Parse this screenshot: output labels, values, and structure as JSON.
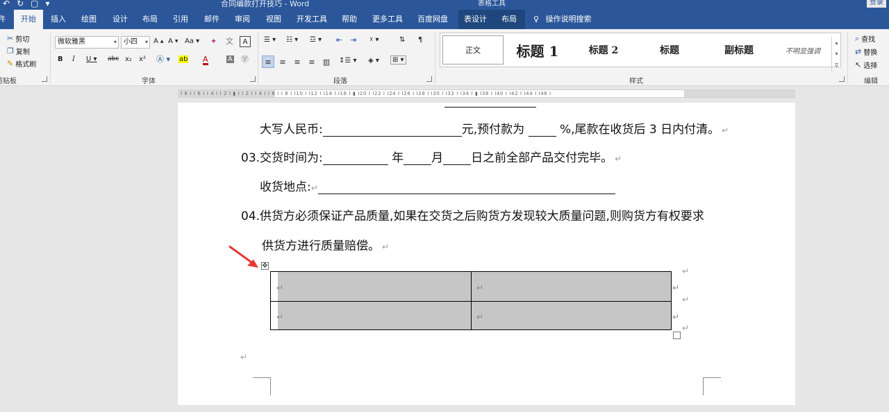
{
  "titlebar": {
    "doc_title": "合同编款打开技巧 - Word",
    "context_title": "表格工具",
    "login": "登录"
  },
  "tabs": [
    {
      "label": "文件"
    },
    {
      "label": "开始"
    },
    {
      "label": "插入"
    },
    {
      "label": "绘图"
    },
    {
      "label": "设计"
    },
    {
      "label": "布局"
    },
    {
      "label": "引用"
    },
    {
      "label": "邮件"
    },
    {
      "label": "审阅"
    },
    {
      "label": "视图"
    },
    {
      "label": "开发工具"
    },
    {
      "label": "帮助"
    },
    {
      "label": "更多工具"
    },
    {
      "label": "百度网盘"
    },
    {
      "label": "表设计"
    },
    {
      "label": "布局"
    },
    {
      "label": "操作说明搜索"
    }
  ],
  "ribbon": {
    "clipboard": {
      "cut": "剪切",
      "copy": "复制",
      "format_painter": "格式刷",
      "label": "剪贴板"
    },
    "font": {
      "name": "微软雅黑",
      "size": "小四",
      "label": "字体"
    },
    "paragraph": {
      "label": "段落"
    },
    "styles": {
      "label": "样式",
      "items": [
        "正文",
        "标题 1",
        "标题 2",
        "标题",
        "副标题",
        "不明显强调"
      ]
    },
    "editing": {
      "find": "查找",
      "replace": "替换",
      "select": "选择",
      "label": "编辑"
    }
  },
  "ruler": {
    "ticks": "I 8 I  I 6 I  I 4 I  I 2 I  ▮  I  I 2 I  I 4 I  I 6 I  I 8 I  I10 I  I12 I  I14 I  I16 I  ▮  I20 I  I22 I  I24 I  I26 I  I28 I  I30 I  I32 I  I34 I  ▮  I38 I  I40 I  I42 I  I44 I  I46 I"
  },
  "document": {
    "line1_a": "大写人民币:",
    "line1_b": "元,预付款为",
    "line1_c": "%,尾款在收货后 3 日内付清。",
    "line2_a": "03.交货时间为:",
    "line2_b": "年",
    "line2_c": "月",
    "line2_d": "日之前全部产品交付完毕。",
    "line3_a": "收货地点:",
    "line4": "04.供货方必须保证产品质量,如果在交货之后购货方发现较大质量问题,则购货方有权要求",
    "line5": "供货方进行质量赔偿。",
    "para_mark": "↵"
  },
  "colors": {
    "accent": "#2b579a",
    "table_fill": "#c6c6c6",
    "annotation": "#e53935"
  }
}
